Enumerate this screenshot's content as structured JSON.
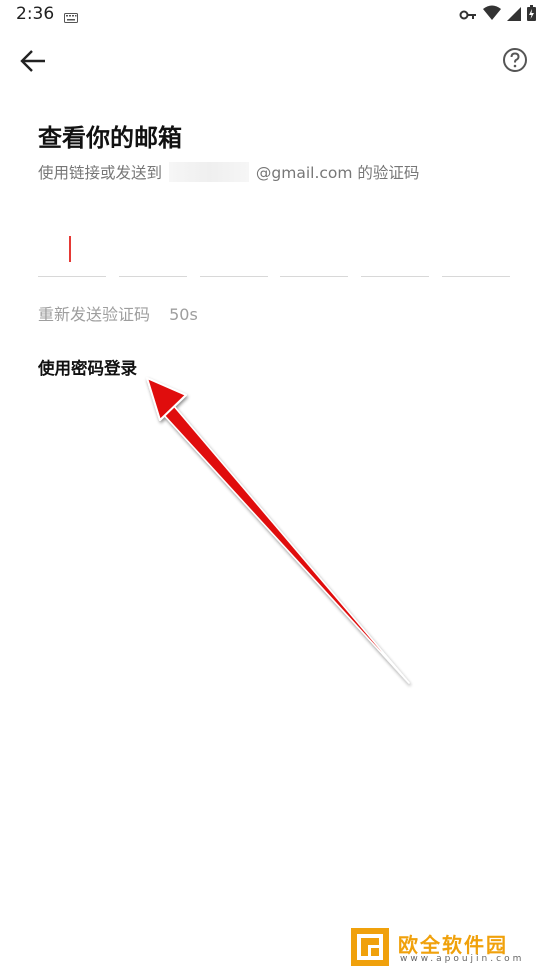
{
  "status_bar": {
    "time": "2:36",
    "icons": [
      "keyboard-icon",
      "vpn-key-icon",
      "wifi-icon",
      "cell-signal-icon",
      "battery-icon"
    ]
  },
  "app_bar": {
    "back_icon": "arrow-back-icon",
    "help_icon": "help-circle-icon"
  },
  "main": {
    "title": "查看你的邮箱",
    "subtitle_prefix": "使用链接或发送到",
    "subtitle_suffix": "@gmail.com 的验证码",
    "code_box_count": 6,
    "resend_label": "重新发送验证码",
    "resend_timer": "50s",
    "password_login_label": "使用密码登录"
  },
  "annotation": {
    "arrow_color": "#e01010"
  },
  "watermark": {
    "name": "欧全软件园",
    "url": "www.apoujin.com"
  },
  "colors": {
    "caret": "#e53935",
    "watermark": "#f0a10c"
  }
}
